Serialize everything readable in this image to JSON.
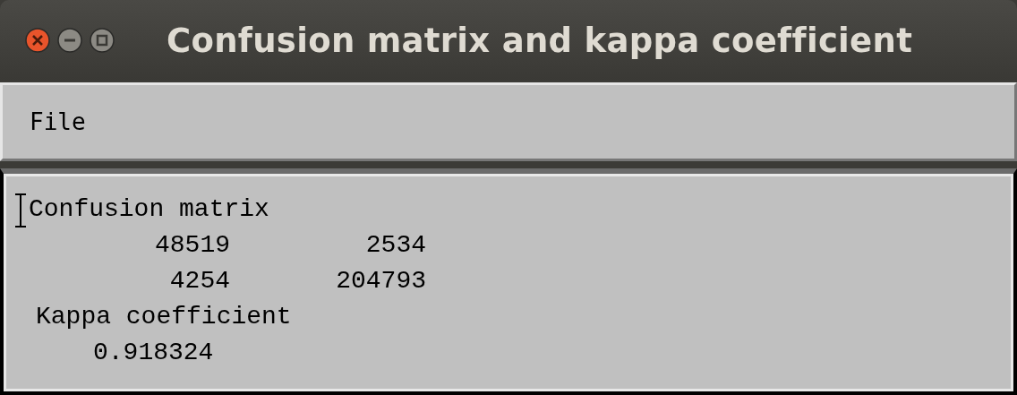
{
  "window": {
    "title": "Confusion matrix and kappa coefficient"
  },
  "menu": [
    {
      "label": "File"
    }
  ],
  "output": {
    "heading": "Confusion matrix",
    "matrix": [
      [
        "48519",
        "2534"
      ],
      [
        "4254",
        "204793"
      ]
    ],
    "kappa_label": "Kappa coefficient",
    "kappa_value": "0.918324"
  }
}
